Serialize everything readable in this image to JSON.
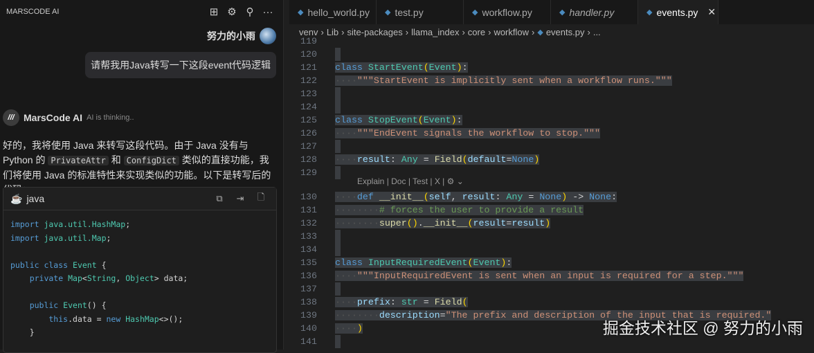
{
  "panel": {
    "title": "MARSCODE AI",
    "icons": [
      "new-chat-icon",
      "gear-icon",
      "feedback-icon",
      "more-icon"
    ],
    "icon_glyphs": [
      "⊞",
      "⚙",
      "⚲",
      "···"
    ]
  },
  "chat": {
    "user_name": "努力的小雨",
    "user_message": "请帮我用Java转写一下这段event代码逻辑",
    "ai_name": "MarsCode AI",
    "ai_status": "AI is thinking..",
    "ai_text_1": "好的，我将使用 Java 来转写这段代码。由于 Java 没有与 Python 的 ",
    "code1": "PrivateAttr",
    "ai_text_2": " 和 ",
    "code2": "ConfigDict",
    "ai_text_3": " 类似的直接功能，我们将使用 Java 的标准特性来实现类似的功能。以下是转写后的代码：",
    "code_block": {
      "lang": "java",
      "actions": [
        "copy",
        "insert",
        "new-file"
      ],
      "lines": [
        [
          [
            "import ",
            "kw"
          ],
          [
            "java.util.",
            "ty"
          ],
          [
            "HashMap",
            "ty"
          ],
          [
            ";",
            "pl"
          ]
        ],
        [
          [
            "import ",
            "kw"
          ],
          [
            "java.util.",
            "ty"
          ],
          [
            "Map",
            "ty"
          ],
          [
            ";",
            "pl"
          ]
        ],
        [],
        [
          [
            "public class ",
            "kw"
          ],
          [
            "Event ",
            "ty"
          ],
          [
            "{",
            "pl"
          ]
        ],
        [
          [
            "    private ",
            "kw"
          ],
          [
            "Map",
            "ty"
          ],
          [
            "<",
            "pl"
          ],
          [
            "String",
            "ty"
          ],
          [
            ", ",
            "pl"
          ],
          [
            "Object",
            "ty"
          ],
          [
            "> data;",
            "pl"
          ]
        ],
        [],
        [
          [
            "    public ",
            "kw"
          ],
          [
            "Event",
            "ty"
          ],
          [
            "() {",
            "pl"
          ]
        ],
        [
          [
            "        this",
            "kw"
          ],
          [
            ".data = ",
            "pl"
          ],
          [
            "new ",
            "kw"
          ],
          [
            "HashMap",
            "ty"
          ],
          [
            "<>();",
            "pl"
          ]
        ],
        [
          [
            "    }",
            "pl"
          ]
        ]
      ]
    }
  },
  "tabs": [
    {
      "label": "hello_world.py"
    },
    {
      "label": "test.py"
    },
    {
      "label": "workflow.py"
    },
    {
      "label": "handler.py",
      "italic": true
    },
    {
      "label": "events.py",
      "active": true
    }
  ],
  "breadcrumb": [
    "venv",
    "Lib",
    "site-packages",
    "llama_index",
    "core",
    "workflow",
    "events.py",
    "..."
  ],
  "codelens": "Explain | Doc | Test | X | ⚙ ⌄",
  "editor_lines": [
    {
      "n": "119",
      "t": []
    },
    {
      "n": "120",
      "t": []
    },
    {
      "n": "121",
      "t": [
        [
          "class ",
          "kw"
        ],
        [
          "StartEvent",
          "ty"
        ],
        [
          "(",
          "br"
        ],
        [
          "Event",
          "ty"
        ],
        [
          ")",
          "br"
        ],
        [
          ":",
          "pl"
        ]
      ]
    },
    {
      "n": "122",
      "t": [
        [
          "····",
          "ws"
        ],
        [
          "\"\"\"StartEvent is implicitly sent when a workflow runs.\"\"\"",
          "st"
        ]
      ]
    },
    {
      "n": "123",
      "t": []
    },
    {
      "n": "124",
      "t": []
    },
    {
      "n": "125",
      "t": [
        [
          "class ",
          "kw"
        ],
        [
          "StopEvent",
          "ty"
        ],
        [
          "(",
          "br"
        ],
        [
          "Event",
          "ty"
        ],
        [
          ")",
          "br"
        ],
        [
          ":",
          "pl"
        ]
      ]
    },
    {
      "n": "126",
      "t": [
        [
          "····",
          "ws"
        ],
        [
          "\"\"\"EndEvent signals the workflow to stop.\"\"\"",
          "st"
        ]
      ]
    },
    {
      "n": "127",
      "t": []
    },
    {
      "n": "128",
      "t": [
        [
          "····",
          "ws"
        ],
        [
          "result",
          "id"
        ],
        [
          ": ",
          "pl"
        ],
        [
          "Any",
          "ty"
        ],
        [
          " = ",
          "pl"
        ],
        [
          "Field",
          "fn"
        ],
        [
          "(",
          "br"
        ],
        [
          "default",
          "id"
        ],
        [
          "=",
          "pl"
        ],
        [
          "None",
          "kw"
        ],
        [
          ")",
          "br"
        ]
      ]
    },
    {
      "n": "129",
      "t": []
    },
    {
      "n": "130",
      "t": [
        [
          "····",
          "ws"
        ],
        [
          "def ",
          "kw"
        ],
        [
          "__init__",
          "fn"
        ],
        [
          "(",
          "br"
        ],
        [
          "self",
          "id"
        ],
        [
          ", ",
          "pl"
        ],
        [
          "result",
          "id"
        ],
        [
          ": ",
          "pl"
        ],
        [
          "Any",
          "ty"
        ],
        [
          " = ",
          "pl"
        ],
        [
          "None",
          "kw"
        ],
        [
          ")",
          "br"
        ],
        [
          " -> ",
          "pl"
        ],
        [
          "None",
          "kw"
        ],
        [
          ":",
          "pl"
        ]
      ]
    },
    {
      "n": "131",
      "t": [
        [
          "········",
          "ws"
        ],
        [
          "# forces the user to provide a result",
          "cm"
        ]
      ]
    },
    {
      "n": "132",
      "t": [
        [
          "········",
          "ws"
        ],
        [
          "super",
          "fn"
        ],
        [
          "()",
          "br"
        ],
        [
          ".",
          "pl"
        ],
        [
          "__init__",
          "fn"
        ],
        [
          "(",
          "br"
        ],
        [
          "result",
          "id"
        ],
        [
          "=",
          "pl"
        ],
        [
          "result",
          "id"
        ],
        [
          ")",
          "br"
        ]
      ]
    },
    {
      "n": "133",
      "t": []
    },
    {
      "n": "134",
      "t": []
    },
    {
      "n": "135",
      "t": [
        [
          "class ",
          "kw"
        ],
        [
          "InputRequiredEvent",
          "ty"
        ],
        [
          "(",
          "br"
        ],
        [
          "Event",
          "ty"
        ],
        [
          ")",
          "br"
        ],
        [
          ":",
          "pl"
        ]
      ]
    },
    {
      "n": "136",
      "t": [
        [
          "····",
          "ws"
        ],
        [
          "\"\"\"InputRequiredEvent is sent when an input is required for a step.\"\"\"",
          "st"
        ]
      ]
    },
    {
      "n": "137",
      "t": []
    },
    {
      "n": "138",
      "t": [
        [
          "····",
          "ws"
        ],
        [
          "prefix",
          "id"
        ],
        [
          ": ",
          "pl"
        ],
        [
          "str",
          "ty"
        ],
        [
          " = ",
          "pl"
        ],
        [
          "Field",
          "fn"
        ],
        [
          "(",
          "br"
        ]
      ]
    },
    {
      "n": "139",
      "t": [
        [
          "········",
          "ws"
        ],
        [
          "description",
          "id"
        ],
        [
          "=",
          "pl"
        ],
        [
          "\"The prefix and description of the input that is required.\"",
          "st"
        ]
      ]
    },
    {
      "n": "140",
      "t": [
        [
          "····",
          "ws"
        ],
        [
          ")",
          "br"
        ]
      ]
    },
    {
      "n": "141",
      "t": []
    }
  ],
  "watermark": "掘金技术社区 @ 努力的小雨"
}
